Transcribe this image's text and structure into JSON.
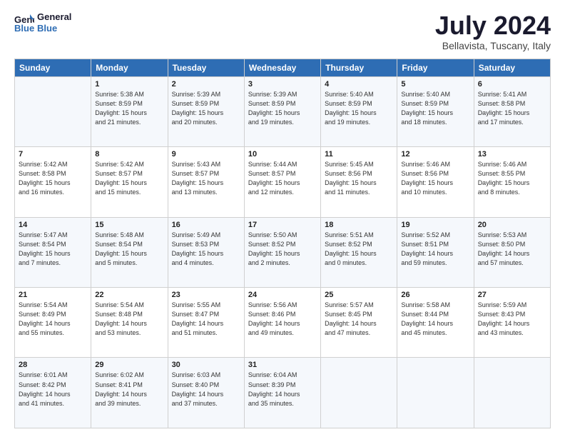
{
  "logo": {
    "line1": "General",
    "line2": "Blue"
  },
  "title": "July 2024",
  "location": "Bellavista, Tuscany, Italy",
  "days_header": [
    "Sunday",
    "Monday",
    "Tuesday",
    "Wednesday",
    "Thursday",
    "Friday",
    "Saturday"
  ],
  "weeks": [
    [
      {
        "num": "",
        "lines": []
      },
      {
        "num": "1",
        "lines": [
          "Sunrise: 5:38 AM",
          "Sunset: 8:59 PM",
          "Daylight: 15 hours",
          "and 21 minutes."
        ]
      },
      {
        "num": "2",
        "lines": [
          "Sunrise: 5:39 AM",
          "Sunset: 8:59 PM",
          "Daylight: 15 hours",
          "and 20 minutes."
        ]
      },
      {
        "num": "3",
        "lines": [
          "Sunrise: 5:39 AM",
          "Sunset: 8:59 PM",
          "Daylight: 15 hours",
          "and 19 minutes."
        ]
      },
      {
        "num": "4",
        "lines": [
          "Sunrise: 5:40 AM",
          "Sunset: 8:59 PM",
          "Daylight: 15 hours",
          "and 19 minutes."
        ]
      },
      {
        "num": "5",
        "lines": [
          "Sunrise: 5:40 AM",
          "Sunset: 8:59 PM",
          "Daylight: 15 hours",
          "and 18 minutes."
        ]
      },
      {
        "num": "6",
        "lines": [
          "Sunrise: 5:41 AM",
          "Sunset: 8:58 PM",
          "Daylight: 15 hours",
          "and 17 minutes."
        ]
      }
    ],
    [
      {
        "num": "7",
        "lines": [
          "Sunrise: 5:42 AM",
          "Sunset: 8:58 PM",
          "Daylight: 15 hours",
          "and 16 minutes."
        ]
      },
      {
        "num": "8",
        "lines": [
          "Sunrise: 5:42 AM",
          "Sunset: 8:57 PM",
          "Daylight: 15 hours",
          "and 15 minutes."
        ]
      },
      {
        "num": "9",
        "lines": [
          "Sunrise: 5:43 AM",
          "Sunset: 8:57 PM",
          "Daylight: 15 hours",
          "and 13 minutes."
        ]
      },
      {
        "num": "10",
        "lines": [
          "Sunrise: 5:44 AM",
          "Sunset: 8:57 PM",
          "Daylight: 15 hours",
          "and 12 minutes."
        ]
      },
      {
        "num": "11",
        "lines": [
          "Sunrise: 5:45 AM",
          "Sunset: 8:56 PM",
          "Daylight: 15 hours",
          "and 11 minutes."
        ]
      },
      {
        "num": "12",
        "lines": [
          "Sunrise: 5:46 AM",
          "Sunset: 8:56 PM",
          "Daylight: 15 hours",
          "and 10 minutes."
        ]
      },
      {
        "num": "13",
        "lines": [
          "Sunrise: 5:46 AM",
          "Sunset: 8:55 PM",
          "Daylight: 15 hours",
          "and 8 minutes."
        ]
      }
    ],
    [
      {
        "num": "14",
        "lines": [
          "Sunrise: 5:47 AM",
          "Sunset: 8:54 PM",
          "Daylight: 15 hours",
          "and 7 minutes."
        ]
      },
      {
        "num": "15",
        "lines": [
          "Sunrise: 5:48 AM",
          "Sunset: 8:54 PM",
          "Daylight: 15 hours",
          "and 5 minutes."
        ]
      },
      {
        "num": "16",
        "lines": [
          "Sunrise: 5:49 AM",
          "Sunset: 8:53 PM",
          "Daylight: 15 hours",
          "and 4 minutes."
        ]
      },
      {
        "num": "17",
        "lines": [
          "Sunrise: 5:50 AM",
          "Sunset: 8:52 PM",
          "Daylight: 15 hours",
          "and 2 minutes."
        ]
      },
      {
        "num": "18",
        "lines": [
          "Sunrise: 5:51 AM",
          "Sunset: 8:52 PM",
          "Daylight: 15 hours",
          "and 0 minutes."
        ]
      },
      {
        "num": "19",
        "lines": [
          "Sunrise: 5:52 AM",
          "Sunset: 8:51 PM",
          "Daylight: 14 hours",
          "and 59 minutes."
        ]
      },
      {
        "num": "20",
        "lines": [
          "Sunrise: 5:53 AM",
          "Sunset: 8:50 PM",
          "Daylight: 14 hours",
          "and 57 minutes."
        ]
      }
    ],
    [
      {
        "num": "21",
        "lines": [
          "Sunrise: 5:54 AM",
          "Sunset: 8:49 PM",
          "Daylight: 14 hours",
          "and 55 minutes."
        ]
      },
      {
        "num": "22",
        "lines": [
          "Sunrise: 5:54 AM",
          "Sunset: 8:48 PM",
          "Daylight: 14 hours",
          "and 53 minutes."
        ]
      },
      {
        "num": "23",
        "lines": [
          "Sunrise: 5:55 AM",
          "Sunset: 8:47 PM",
          "Daylight: 14 hours",
          "and 51 minutes."
        ]
      },
      {
        "num": "24",
        "lines": [
          "Sunrise: 5:56 AM",
          "Sunset: 8:46 PM",
          "Daylight: 14 hours",
          "and 49 minutes."
        ]
      },
      {
        "num": "25",
        "lines": [
          "Sunrise: 5:57 AM",
          "Sunset: 8:45 PM",
          "Daylight: 14 hours",
          "and 47 minutes."
        ]
      },
      {
        "num": "26",
        "lines": [
          "Sunrise: 5:58 AM",
          "Sunset: 8:44 PM",
          "Daylight: 14 hours",
          "and 45 minutes."
        ]
      },
      {
        "num": "27",
        "lines": [
          "Sunrise: 5:59 AM",
          "Sunset: 8:43 PM",
          "Daylight: 14 hours",
          "and 43 minutes."
        ]
      }
    ],
    [
      {
        "num": "28",
        "lines": [
          "Sunrise: 6:01 AM",
          "Sunset: 8:42 PM",
          "Daylight: 14 hours",
          "and 41 minutes."
        ]
      },
      {
        "num": "29",
        "lines": [
          "Sunrise: 6:02 AM",
          "Sunset: 8:41 PM",
          "Daylight: 14 hours",
          "and 39 minutes."
        ]
      },
      {
        "num": "30",
        "lines": [
          "Sunrise: 6:03 AM",
          "Sunset: 8:40 PM",
          "Daylight: 14 hours",
          "and 37 minutes."
        ]
      },
      {
        "num": "31",
        "lines": [
          "Sunrise: 6:04 AM",
          "Sunset: 8:39 PM",
          "Daylight: 14 hours",
          "and 35 minutes."
        ]
      },
      {
        "num": "",
        "lines": []
      },
      {
        "num": "",
        "lines": []
      },
      {
        "num": "",
        "lines": []
      }
    ]
  ]
}
